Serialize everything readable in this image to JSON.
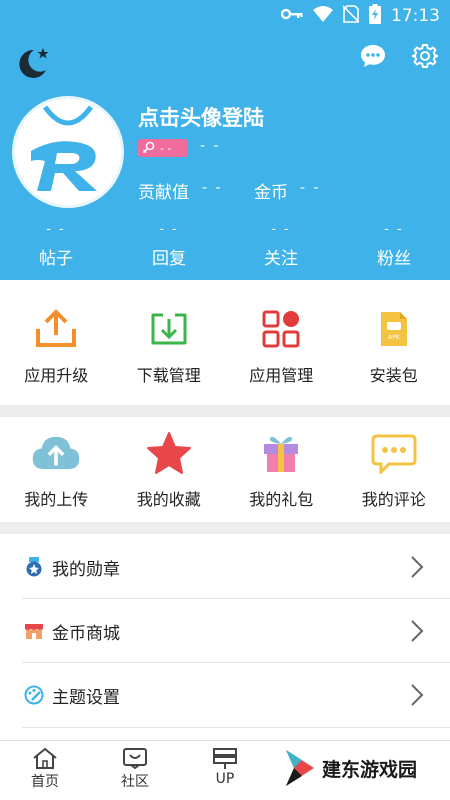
{
  "status_bar": {
    "time": "17:13"
  },
  "header": {
    "login_prompt": "点击头像登陆",
    "level_text": "- -",
    "level_value": "- -",
    "contribution_label": "贡献值",
    "contribution_value": "- -",
    "coins_label": "金币",
    "coins_value": "- -",
    "counters": [
      {
        "value": "- -",
        "label": "帖子"
      },
      {
        "value": "- -",
        "label": "回复"
      },
      {
        "value": "- -",
        "label": "关注"
      },
      {
        "value": "- -",
        "label": "粉丝"
      }
    ]
  },
  "tools_row": [
    {
      "label": "应用升级",
      "icon": "upload-tray-icon",
      "color": "#f4902c"
    },
    {
      "label": "下载管理",
      "icon": "download-tray-icon",
      "color": "#3cb44a"
    },
    {
      "label": "应用管理",
      "icon": "app-grid-icon",
      "color": "#e23b3b"
    },
    {
      "label": "安装包",
      "icon": "apk-file-icon",
      "color": "#f5c342"
    }
  ],
  "my_row": [
    {
      "label": "我的上传",
      "icon": "cloud-upload-icon",
      "color": "#7fc1d6"
    },
    {
      "label": "我的收藏",
      "icon": "star-icon",
      "color": "#e8474a"
    },
    {
      "label": "我的礼包",
      "icon": "gift-icon",
      "color": "#b48be0"
    },
    {
      "label": "我的评论",
      "icon": "comment-icon",
      "color": "#f5c342"
    }
  ],
  "list": [
    {
      "label": "我的勋章",
      "icon": "medal-icon"
    },
    {
      "label": "金币商城",
      "icon": "shop-icon"
    },
    {
      "label": "主题设置",
      "icon": "palette-icon"
    }
  ],
  "tabbar": [
    {
      "label": "首页",
      "icon": "home-icon"
    },
    {
      "label": "社区",
      "icon": "community-icon"
    },
    {
      "label": "UP",
      "icon": "up-icon"
    }
  ],
  "watermark": {
    "text": "建东游戏园"
  },
  "colors": {
    "header_bg": "#3fb2ea",
    "badge": "#f06c9c"
  }
}
